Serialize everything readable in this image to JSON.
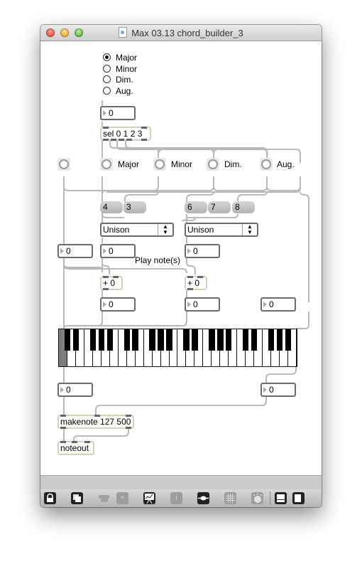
{
  "window": {
    "title": "Max 03.13 chord_builder_3",
    "controls": [
      "close",
      "minimize",
      "zoom"
    ]
  },
  "patch": {
    "radio_group": {
      "options": [
        "Major",
        "Minor",
        "Dim.",
        "Aug."
      ],
      "selected": "Major"
    },
    "number_boxes": {
      "radio_out": "0",
      "left_input": "0",
      "major_offset": "0",
      "minor_offset": "0",
      "sum_left": "0",
      "sum_right": "0",
      "right_out": "0",
      "kbd_left_out": "0",
      "kbd_right_out": "0"
    },
    "sel_object": "sel 0 1 2 3",
    "buttons": [
      {
        "label": ""
      },
      {
        "label": "Major"
      },
      {
        "label": "Minor"
      },
      {
        "label": "Dim."
      },
      {
        "label": "Aug."
      }
    ],
    "messages_left": [
      "4",
      "3"
    ],
    "messages_right": [
      "6",
      "7",
      "8"
    ],
    "umenu_left": "Unison",
    "umenu_right": "Unison",
    "comment": "Play note(s)",
    "add_left": "+ 0",
    "add_right": "+ 0",
    "makenote": "makenote 127 500",
    "noteout": "noteout",
    "keyboard": {
      "octaves": 4,
      "highlighted_key": "C"
    }
  },
  "toolbar": {
    "items": [
      {
        "icon": "lock-icon",
        "enabled": true
      },
      {
        "icon": "new-object-icon",
        "enabled": true
      },
      {
        "icon": "clue-icon",
        "enabled": false
      },
      {
        "icon": "delete-icon",
        "enabled": false
      },
      {
        "icon": "presentation-icon",
        "enabled": true
      },
      {
        "icon": "info-icon",
        "enabled": false
      },
      {
        "icon": "patch-cord-icon",
        "enabled": true
      },
      {
        "icon": "grid-icon",
        "enabled": false
      },
      {
        "icon": "dsp-icon",
        "enabled": false
      },
      {
        "icon": "bottom-panel-icon",
        "enabled": true
      },
      {
        "icon": "right-panel-icon",
        "enabled": true
      }
    ],
    "info_glyph": "i",
    "delete_glyph": "×"
  }
}
